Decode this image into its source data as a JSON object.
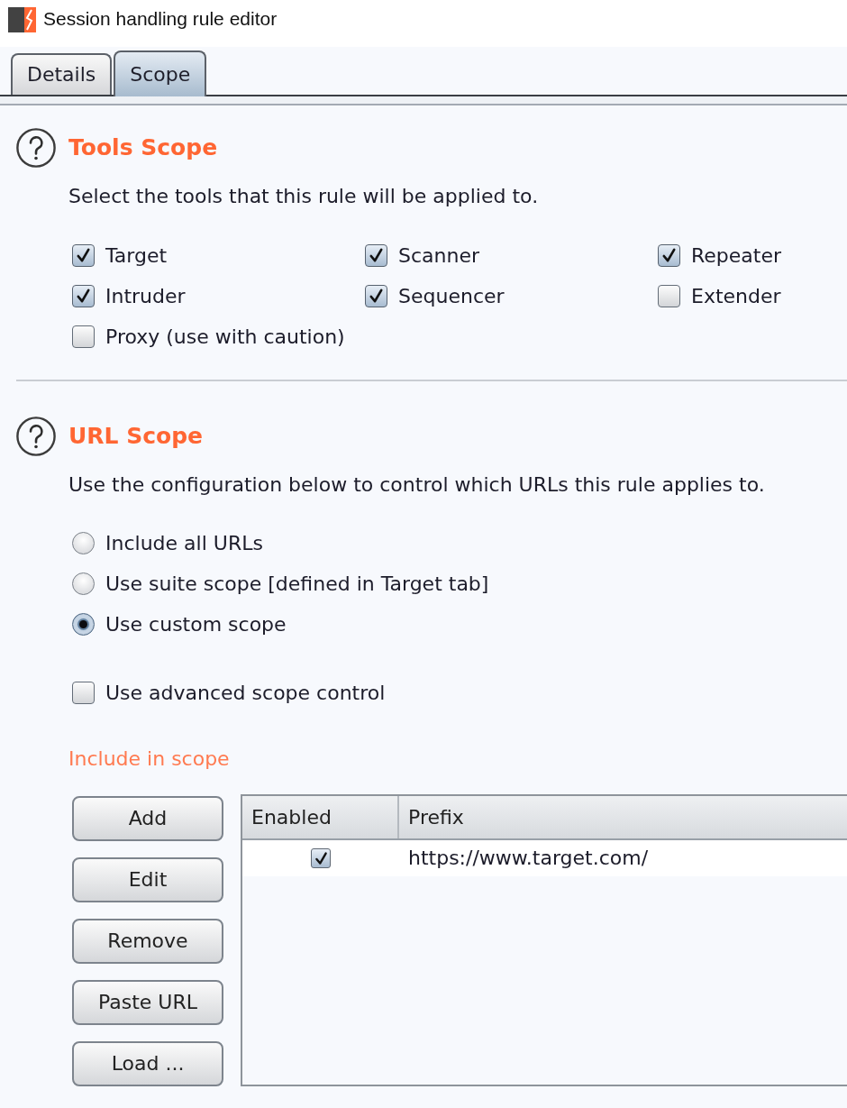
{
  "window": {
    "title": "Session handling rule editor"
  },
  "tabs": [
    {
      "label": "Details",
      "selected": false
    },
    {
      "label": "Scope",
      "selected": true
    }
  ],
  "tools_scope": {
    "title": "Tools Scope",
    "description": "Select the tools that this rule will be applied to.",
    "tools": [
      {
        "label": "Target",
        "checked": true
      },
      {
        "label": "Scanner",
        "checked": true
      },
      {
        "label": "Repeater",
        "checked": true
      },
      {
        "label": "Intruder",
        "checked": true
      },
      {
        "label": "Sequencer",
        "checked": true
      },
      {
        "label": "Extender",
        "checked": false
      },
      {
        "label": "Proxy (use with caution)",
        "checked": false
      }
    ]
  },
  "url_scope": {
    "title": "URL Scope",
    "description": "Use the configuration below to control which URLs this rule applies to.",
    "options": [
      {
        "label": "Include all URLs",
        "selected": false
      },
      {
        "label": "Use suite scope [defined in Target tab]",
        "selected": false
      },
      {
        "label": "Use custom scope",
        "selected": true
      }
    ],
    "advanced_scope_control": {
      "label": "Use advanced scope control",
      "checked": false
    },
    "include_in_scope": {
      "title": "Include in scope",
      "buttons": [
        "Add",
        "Edit",
        "Remove",
        "Paste URL",
        "Load ..."
      ],
      "table": {
        "columns": [
          "Enabled",
          "Prefix"
        ],
        "rows": [
          {
            "enabled": true,
            "prefix": "https://www.target.com/"
          }
        ]
      }
    }
  }
}
